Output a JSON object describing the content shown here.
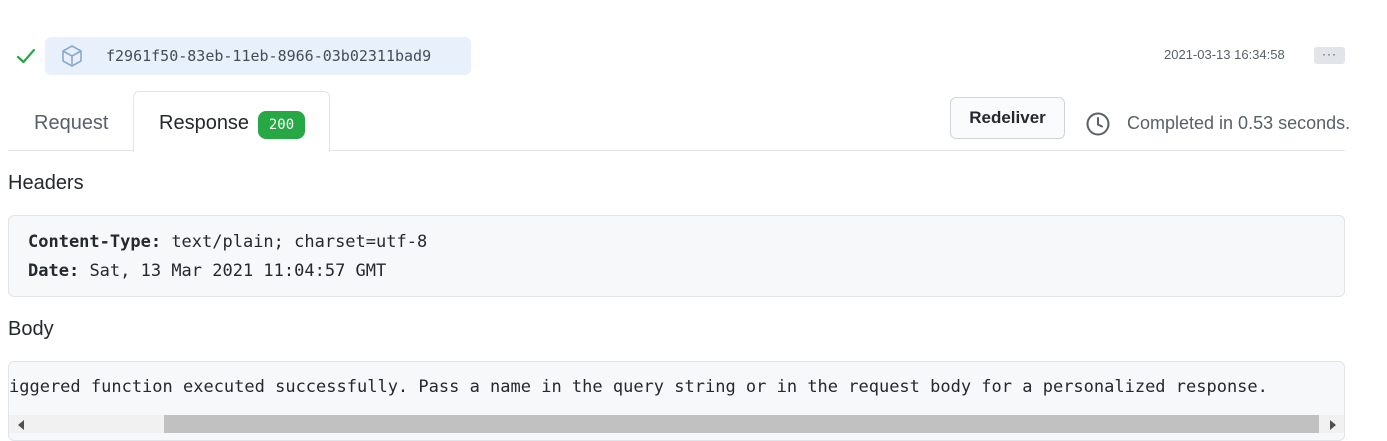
{
  "delivery": {
    "status_icon": "check-icon",
    "type_icon": "package-icon",
    "guid": "f2961f50-83eb-11eb-8966-03b02311bad9",
    "timestamp": "2021-03-13 16:34:58",
    "more_label": "···"
  },
  "tabs": {
    "request_label": "Request",
    "response_label": "Response",
    "status_code": "200"
  },
  "actions": {
    "redeliver_label": "Redeliver",
    "clock_icon": "clock-icon",
    "completed_text": "Completed in 0.53 seconds."
  },
  "headers": {
    "title": "Headers",
    "items": [
      {
        "key": "Content-Type:",
        "value": "text/plain; charset=utf-8"
      },
      {
        "key": "Date:",
        "value": "Sat, 13 Mar 2021 11:04:57 GMT"
      }
    ]
  },
  "body": {
    "title": "Body",
    "content": "iggered function executed successfully. Pass a name in the query string or in the request body for a personalized response."
  },
  "colors": {
    "success": "#28a745",
    "pill_background": "#e8f1fb"
  }
}
